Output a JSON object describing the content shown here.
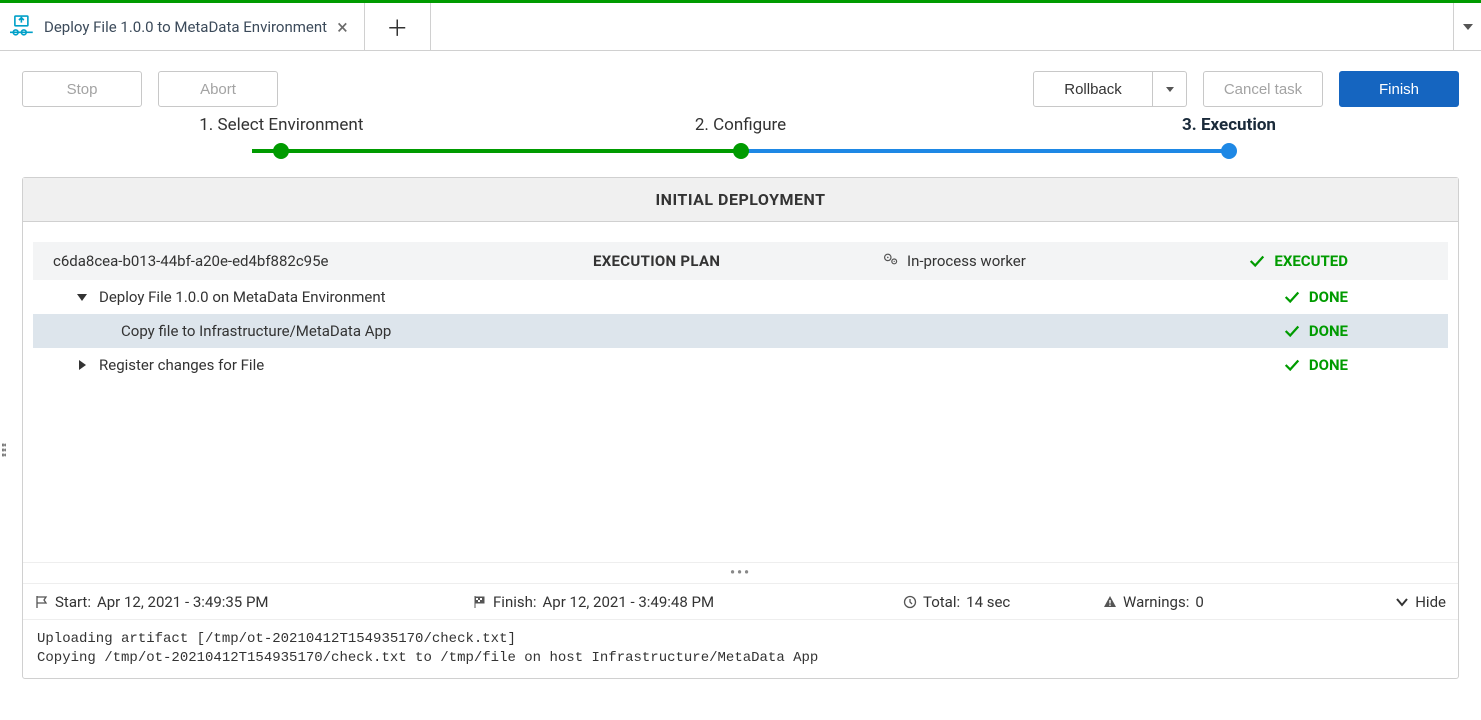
{
  "tab": {
    "title": "Deploy File 1.0.0 to MetaData Environment"
  },
  "actions": {
    "stop": "Stop",
    "abort": "Abort",
    "rollback": "Rollback",
    "cancel": "Cancel task",
    "finish": "Finish"
  },
  "stepper": {
    "step1": "1. Select Environment",
    "step2": "2. Configure",
    "step3": "3. Execution"
  },
  "panel": {
    "title": "INITIAL DEPLOYMENT"
  },
  "plan": {
    "id": "c6da8cea-b013-44bf-a20e-ed4bf882c95e",
    "center_label": "EXECUTION PLAN",
    "worker": "In-process worker",
    "status": "EXECUTED"
  },
  "tree": [
    {
      "label": "Deploy File 1.0.0 on MetaData Environment",
      "status": "DONE"
    },
    {
      "label": "Copy file to Infrastructure/MetaData App",
      "status": "DONE"
    },
    {
      "label": "Register changes for File",
      "status": "DONE"
    }
  ],
  "footer": {
    "start_label": "Start:",
    "start_value": "Apr 12, 2021 - 3:49:35 PM",
    "finish_label": "Finish:",
    "finish_value": "Apr 12, 2021 - 3:49:48 PM",
    "total_label": "Total:",
    "total_value": "14 sec",
    "warnings_label": "Warnings:",
    "warnings_value": "0",
    "hide": "Hide"
  },
  "log": "Uploading artifact [/tmp/ot-20210412T154935170/check.txt]\nCopying /tmp/ot-20210412T154935170/check.txt to /tmp/file on host Infrastructure/MetaData App"
}
